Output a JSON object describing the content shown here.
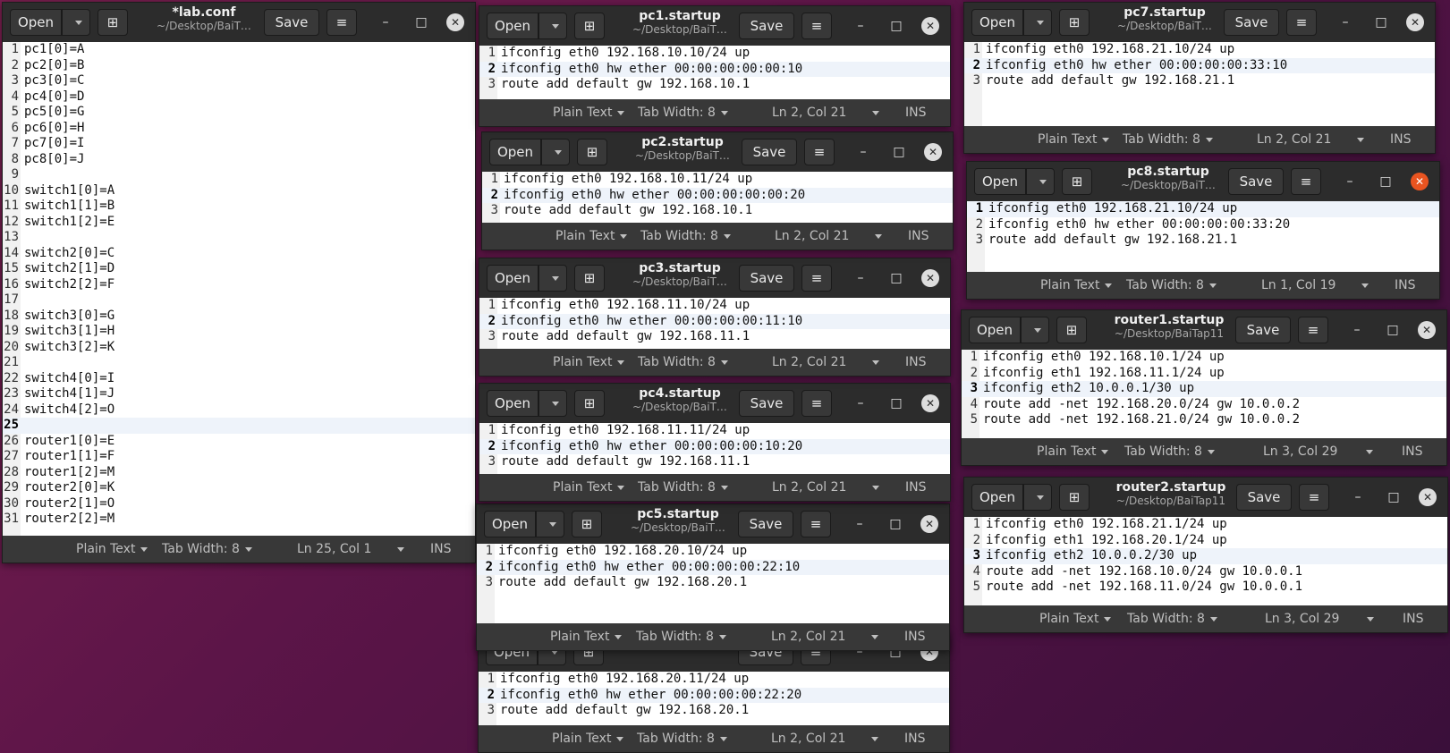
{
  "common": {
    "open_label": "Open",
    "save_label": "Save",
    "subtitle_short": "~/Desktop/BaiT…",
    "subtitle_full": "~/Desktop/BaiTap11",
    "plain_text": "Plain Text",
    "tab_width": "Tab Width: 8",
    "ins": "INS",
    "minimize": "–",
    "maximize": "□",
    "close": "✕"
  },
  "windows": {
    "lab": {
      "title": "*lab.conf",
      "status": "Ln 25, Col 1",
      "lines": [
        "pc1[0]=A",
        "pc2[0]=B",
        "pc3[0]=C",
        "pc4[0]=D",
        "pc5[0]=G",
        "pc6[0]=H",
        "pc7[0]=I",
        "pc8[0]=J",
        "",
        "switch1[0]=A",
        "switch1[1]=B",
        "switch1[2]=E",
        "",
        "switch2[0]=C",
        "switch2[1]=D",
        "switch2[2]=F",
        "",
        "switch3[0]=G",
        "switch3[1]=H",
        "switch3[2]=K",
        "",
        "switch4[0]=I",
        "switch4[1]=J",
        "switch4[2]=O",
        "",
        "router1[0]=E",
        "router1[1]=F",
        "router1[2]=M",
        "router2[0]=K",
        "router2[1]=O",
        "router2[2]=M"
      ]
    },
    "pc1": {
      "title": "pc1.startup",
      "status": "Ln 2, Col 21",
      "lines": [
        "ifconfig eth0 192.168.10.10/24 up",
        "ifconfig eth0 hw ether 00:00:00:00:00:10",
        "route add default gw 192.168.10.1"
      ]
    },
    "pc2": {
      "title": "pc2.startup",
      "status": "Ln 2, Col 21",
      "lines": [
        "ifconfig eth0 192.168.10.11/24 up",
        "ifconfig eth0 hw ether 00:00:00:00:00:20",
        "route add default gw 192.168.10.1"
      ]
    },
    "pc3": {
      "title": "pc3.startup",
      "status": "Ln 2, Col 21",
      "lines": [
        "ifconfig eth0 192.168.11.10/24 up",
        "ifconfig eth0 hw ether 00:00:00:00:11:10",
        "route add default gw 192.168.11.1"
      ]
    },
    "pc4": {
      "title": "pc4.startup",
      "status": "Ln 2, Col 21",
      "lines": [
        "ifconfig eth0 192.168.11.11/24 up",
        "ifconfig eth0 hw ether 00:00:00:00:10:20",
        "route add default gw 192.168.11.1"
      ]
    },
    "pc5": {
      "title": "pc5.startup",
      "status": "Ln 2, Col 21",
      "lines": [
        "ifconfig eth0 192.168.20.10/24 up",
        "ifconfig eth0 hw ether 00:00:00:00:22:10",
        "route add default gw 192.168.20.1"
      ]
    },
    "pc6": {
      "title": "",
      "status": "Ln 2, Col 21",
      "lines": [
        "ifconfig eth0 192.168.20.11/24 up",
        "ifconfig eth0 hw ether 00:00:00:00:22:20",
        "route add default gw 192.168.20.1"
      ]
    },
    "pc7": {
      "title": "pc7.startup",
      "status": "Ln 2, Col 21",
      "lines": [
        "ifconfig eth0 192.168.21.10/24 up",
        "ifconfig eth0 hw ether 00:00:00:00:33:10",
        "route add default gw 192.168.21.1"
      ]
    },
    "pc8": {
      "title": "pc8.startup",
      "status": "Ln 1, Col 19",
      "lines": [
        "ifconfig eth0 192.168.21.10/24 up",
        "ifconfig eth0 hw ether 00:00:00:00:33:20",
        "route add default gw 192.168.21.1"
      ]
    },
    "router1": {
      "title": "router1.startup",
      "status": "Ln 3, Col 29",
      "lines": [
        "ifconfig eth0 192.168.10.1/24 up",
        "ifconfig eth1 192.168.11.1/24 up",
        "ifconfig eth2 10.0.0.1/30 up",
        "route add -net 192.168.20.0/24 gw 10.0.0.2",
        "route add -net 192.168.21.0/24 gw 10.0.0.2"
      ]
    },
    "router2": {
      "title": "router2.startup",
      "status": "Ln 3, Col 29",
      "lines": [
        "ifconfig eth0 192.168.21.1/24 up",
        "ifconfig eth1 192.168.20.1/24 up",
        "ifconfig eth2 10.0.0.2/30 up",
        "route add -net 192.168.10.0/24 gw 10.0.0.1",
        "route add -net 192.168.11.0/24 gw 10.0.0.1"
      ]
    }
  }
}
